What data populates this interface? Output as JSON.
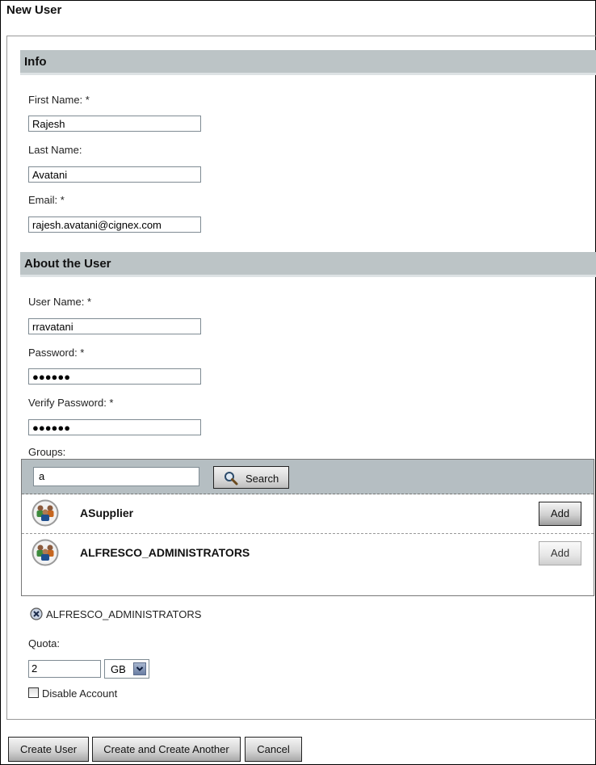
{
  "page": {
    "title": "New User"
  },
  "sections": {
    "info": {
      "title": "Info"
    },
    "about": {
      "title": "About the User"
    }
  },
  "info": {
    "first_name": {
      "label": "First Name: *",
      "value": "Rajesh"
    },
    "last_name": {
      "label": "Last Name:",
      "value": "Avatani"
    },
    "email": {
      "label": "Email: *",
      "value": "rajesh.avatani@cignex.com"
    }
  },
  "about": {
    "username": {
      "label": "User Name: *",
      "value": "rravatani"
    },
    "password": {
      "label": "Password: *",
      "value": "●●●●●●"
    },
    "verify_password": {
      "label": "Verify Password: *",
      "value": "●●●●●●"
    },
    "groups_label": "Groups:"
  },
  "groups": {
    "search_value": "a",
    "search_button": "Search",
    "results": [
      {
        "name": "ASupplier",
        "add_label": "Add",
        "icon": "group-icon"
      },
      {
        "name": "ALFRESCO_ADMINISTRATORS",
        "add_label": "Add",
        "icon": "group-icon"
      }
    ],
    "selected": [
      {
        "name": "ALFRESCO_ADMINISTRATORS",
        "icon": "remove-icon"
      }
    ]
  },
  "quota": {
    "label": "Quota:",
    "value": "2",
    "unit": "GB"
  },
  "disable_account": {
    "label": "Disable Account",
    "checked": false
  },
  "buttons": {
    "create_user": "Create User",
    "create_another": "Create and Create Another",
    "cancel": "Cancel"
  }
}
